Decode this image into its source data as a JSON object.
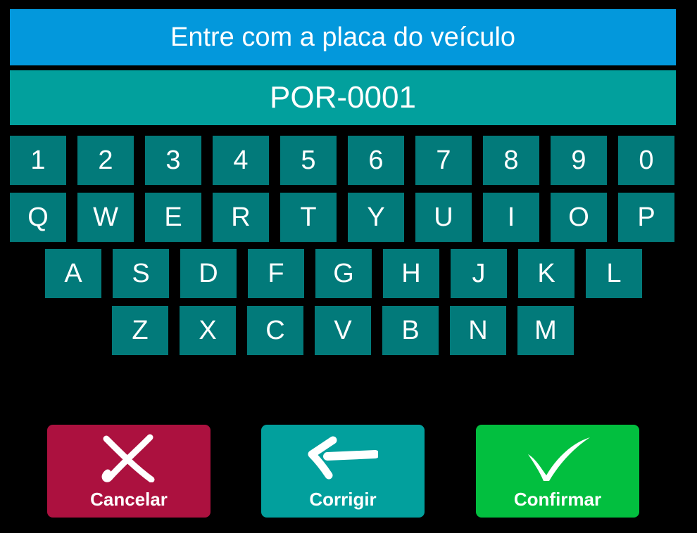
{
  "header": {
    "title": "Entre com a placa do veículo"
  },
  "plate": {
    "value": "POR-0001"
  },
  "keyboard": {
    "row1": [
      "1",
      "2",
      "3",
      "4",
      "5",
      "6",
      "7",
      "8",
      "9",
      "0"
    ],
    "row2": [
      "Q",
      "W",
      "E",
      "R",
      "T",
      "Y",
      "U",
      "I",
      "O",
      "P"
    ],
    "row3": [
      "A",
      "S",
      "D",
      "F",
      "G",
      "H",
      "J",
      "K",
      "L"
    ],
    "row4": [
      "Z",
      "X",
      "C",
      "V",
      "B",
      "N",
      "M"
    ]
  },
  "actions": {
    "cancel": {
      "label": "Cancelar",
      "icon": "x-mark-icon",
      "color": "#AC113F"
    },
    "correct": {
      "label": "Corrigir",
      "icon": "arrow-left-icon",
      "color": "#02A09D"
    },
    "confirm": {
      "label": "Confirmar",
      "icon": "checkmark-icon",
      "color": "#02BF3F"
    }
  },
  "colors": {
    "background": "#000000",
    "title_bar": "#0398DC",
    "plate_display": "#02A09D",
    "key": "#027A7A",
    "text": "#FFFFFF"
  }
}
